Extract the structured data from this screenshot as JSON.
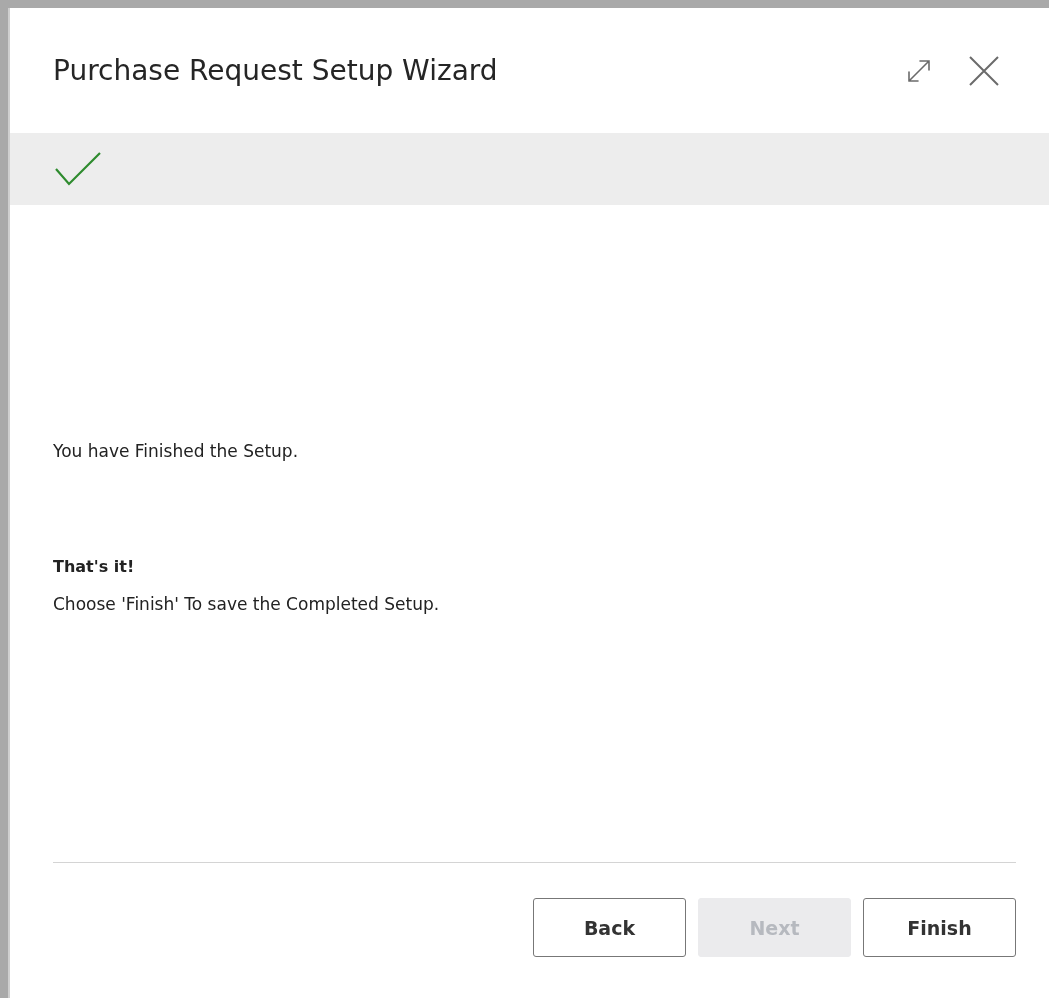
{
  "dialog": {
    "title": "Purchase Request Setup Wizard"
  },
  "progress": {
    "completed": true
  },
  "messages": [
    {
      "kind": "plain",
      "text": "You have Finished the Setup."
    },
    {
      "kind": "heading",
      "text": "That's it!"
    },
    {
      "kind": "plain",
      "text": "Choose 'Finish' To save the Completed Setup."
    }
  ],
  "buttons": [
    {
      "label": "Back",
      "disabled": false
    },
    {
      "label": "Next",
      "disabled": true
    },
    {
      "label": "Finish",
      "disabled": false
    }
  ]
}
